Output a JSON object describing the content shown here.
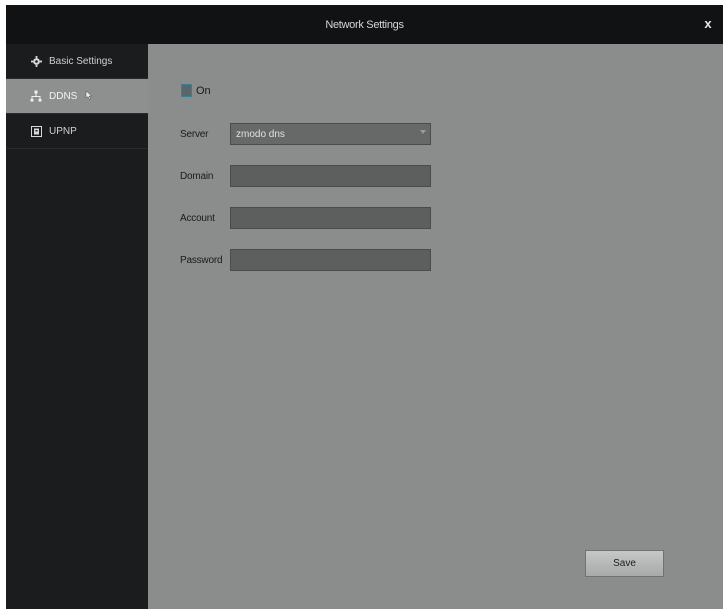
{
  "window": {
    "title": "Network Settings",
    "close_label": "x"
  },
  "sidebar": {
    "items": [
      {
        "label": "Basic Settings",
        "icon": "gear-icon"
      },
      {
        "label": "DDNS",
        "icon": "network-icon"
      },
      {
        "label": "UPNP",
        "icon": "upnp-icon"
      }
    ]
  },
  "form": {
    "enable_label": "On",
    "enabled": true,
    "fields": [
      {
        "label": "Server",
        "value": "zmodo dns"
      },
      {
        "label": "Domain",
        "value": ""
      },
      {
        "label": "Account",
        "value": ""
      },
      {
        "label": "Password",
        "value": ""
      }
    ]
  },
  "actions": {
    "save_label": "Save"
  },
  "colors": {
    "titlebar": "#111214",
    "sidebar": "#1b1c1e",
    "panel": "#8a8d8b",
    "field": "#5c5f5e"
  }
}
